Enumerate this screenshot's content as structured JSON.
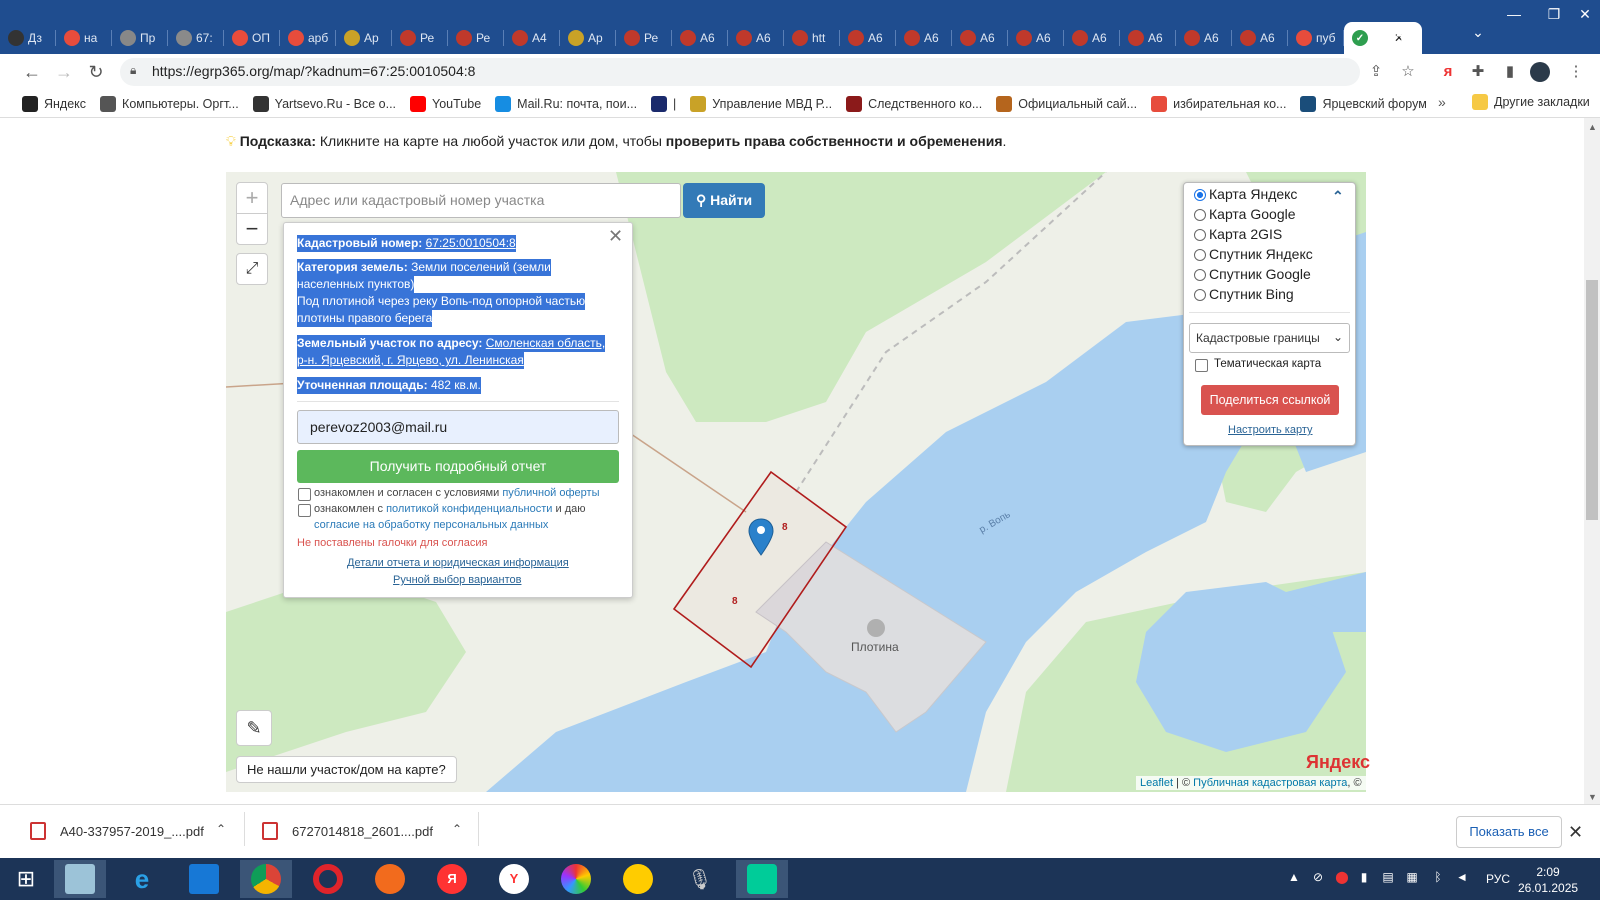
{
  "browser": {
    "tabs": [
      {
        "label": "Дз",
        "icon": "plus-square-icon",
        "color": "#333333"
      },
      {
        "label": "на",
        "icon": "yandex-icon",
        "color": "#e74c3c"
      },
      {
        "label": "Пр",
        "icon": "circle-icon",
        "color": "#888888"
      },
      {
        "label": "67:",
        "icon": "globe-icon",
        "color": "#8a8a8a"
      },
      {
        "label": "ОП",
        "icon": "yandex-icon",
        "color": "#e74c3c"
      },
      {
        "label": "арб",
        "icon": "yandex-icon",
        "color": "#e74c3c"
      },
      {
        "label": "Ар",
        "icon": "emblem-icon",
        "color": "#c9a227"
      },
      {
        "label": "Ре",
        "icon": "eagle-icon",
        "color": "#c0392b"
      },
      {
        "label": "Ре",
        "icon": "eagle-icon",
        "color": "#c0392b"
      },
      {
        "label": "А4",
        "icon": "eagle-icon",
        "color": "#c0392b"
      },
      {
        "label": "Ар",
        "icon": "emblem-icon",
        "color": "#c9a227"
      },
      {
        "label": "Ре",
        "icon": "eagle-icon",
        "color": "#c0392b"
      },
      {
        "label": "А6",
        "icon": "eagle-icon",
        "color": "#c0392b"
      },
      {
        "label": "А6",
        "icon": "eagle-icon",
        "color": "#c0392b"
      },
      {
        "label": "htt",
        "icon": "eagle-icon",
        "color": "#c0392b"
      },
      {
        "label": "А6",
        "icon": "eagle-icon",
        "color": "#c0392b"
      },
      {
        "label": "А6",
        "icon": "eagle-icon",
        "color": "#c0392b"
      },
      {
        "label": "А6",
        "icon": "eagle-icon",
        "color": "#c0392b"
      },
      {
        "label": "А6",
        "icon": "eagle-icon",
        "color": "#c0392b"
      },
      {
        "label": "А6",
        "icon": "eagle-icon",
        "color": "#c0392b"
      },
      {
        "label": "А6",
        "icon": "eagle-icon",
        "color": "#c0392b"
      },
      {
        "label": "А6",
        "icon": "eagle-icon",
        "color": "#c0392b"
      },
      {
        "label": "А6",
        "icon": "eagle-icon",
        "color": "#c0392b"
      },
      {
        "label": "пуб",
        "icon": "yandex-icon",
        "color": "#e74c3c"
      }
    ],
    "active_tab_icon": "check-circle-icon",
    "url": "https://egrp365.org/map/?kadnum=67:25:0010504:8",
    "bookmarks": [
      {
        "label": "Яндекс",
        "color": "#222222"
      },
      {
        "label": "Компьютеры. Оргт...",
        "color": "#555555"
      },
      {
        "label": "Yartsevo.Ru - Все о...",
        "color": "#333333"
      },
      {
        "label": "YouTube",
        "color": "#ff0000"
      },
      {
        "label": "Mail.Ru: почта, пои...",
        "color": "#168de2"
      },
      {
        "label": "|",
        "color": "#1a2a6c"
      },
      {
        "label": "Управление МВД Р...",
        "color": "#c9a227"
      },
      {
        "label": "Следственного ко...",
        "color": "#8b1a1a"
      },
      {
        "label": "Официальный сай...",
        "color": "#b5651d"
      },
      {
        "label": "избирательная ко...",
        "color": "#e74c3c"
      },
      {
        "label": "Ярцевский форум",
        "color": "#1a4d7a"
      }
    ],
    "bookmarks_more": "»",
    "other_bookmarks": "Другие закладки"
  },
  "page": {
    "hint_label": "Подсказка:",
    "hint_text": " Кликните на карте на любой участок или дом, чтобы ",
    "hint_bold": "проверить права собственности и обременения",
    "hint_end": "."
  },
  "map": {
    "search_placeholder": "Адрес или кадастровый номер участка",
    "find_label": "Найти",
    "zoom_in": "+",
    "zoom_out": "−",
    "not_found": "Не нашли участок/дом на карте?",
    "parcel_number_label": "8",
    "parcel_number_label2": "8",
    "dam_label": "Плотина",
    "river_label": "р. Вопь",
    "yandex_logo": "Яндекс",
    "attrib_leaflet": "Leaflet",
    "attrib_sep": " | © ",
    "attrib_pkk": "Публичная кадастровая карта",
    "attrib_end": ", ©"
  },
  "popup": {
    "cad_label": "Кадастровый номер:",
    "cad_value": "67:25:0010504:8",
    "cat_label": "Категория земель:",
    "cat_value_1": "Земли поселений (земли",
    "cat_value_2": "населенных пунктов)",
    "desc_1": "Под плотиной через реку Вопь-под опорной частью",
    "desc_2": "плотины правого берега",
    "addr_label": "Земельный участок по адресу:",
    "addr_value_1": "Смоленская область,",
    "addr_value_2": "р-н. Ярцевский, г. Ярцево, ул. Ленинская",
    "area_label": "Уточненная площадь:",
    "area_value": "482 кв.м.",
    "email": "perevoz2003@mail.ru",
    "report_button": "Получить подробный отчет",
    "consent1_text": "ознакомлен и согласен с условиями ",
    "consent1_link": "публичной оферты",
    "consent2_text": "ознакомлен с ",
    "consent2_link": "политикой конфиденциальности",
    "consent2_text2": " и даю",
    "consent2_link2": "согласие на обработку персональных данных",
    "error": "Не поставлены галочки для согласия",
    "details_link": "Детали отчета и юридическая информация",
    "manual_link": "Ручной выбор вариантов"
  },
  "layers": {
    "options": [
      {
        "label": "Карта Яндекс",
        "selected": true
      },
      {
        "label": "Карта Google",
        "selected": false
      },
      {
        "label": "Карта 2GIS",
        "selected": false
      },
      {
        "label": "Спутник Яндекс",
        "selected": false
      },
      {
        "label": "Спутник Google",
        "selected": false
      },
      {
        "label": "Спутник Bing",
        "selected": false
      }
    ],
    "overlay_select": "Кадастровые границы",
    "thematic_label": "Тематическая карта",
    "share_button": "Поделиться ссылкой",
    "configure_link": "Настроить карту"
  },
  "downloads": {
    "items": [
      "А40-337957-2019_....pdf",
      "6727014818_2601....pdf"
    ],
    "show_all": "Показать все"
  },
  "taskbar": {
    "lang": "РУС",
    "time": "2:09",
    "date": "26.01.2025"
  },
  "colors": {
    "water": "#a9cff0",
    "forest": "#cde9c0",
    "land": "#eef0e8",
    "parcel": "#b01c1c",
    "marker": "#2a81cb"
  }
}
